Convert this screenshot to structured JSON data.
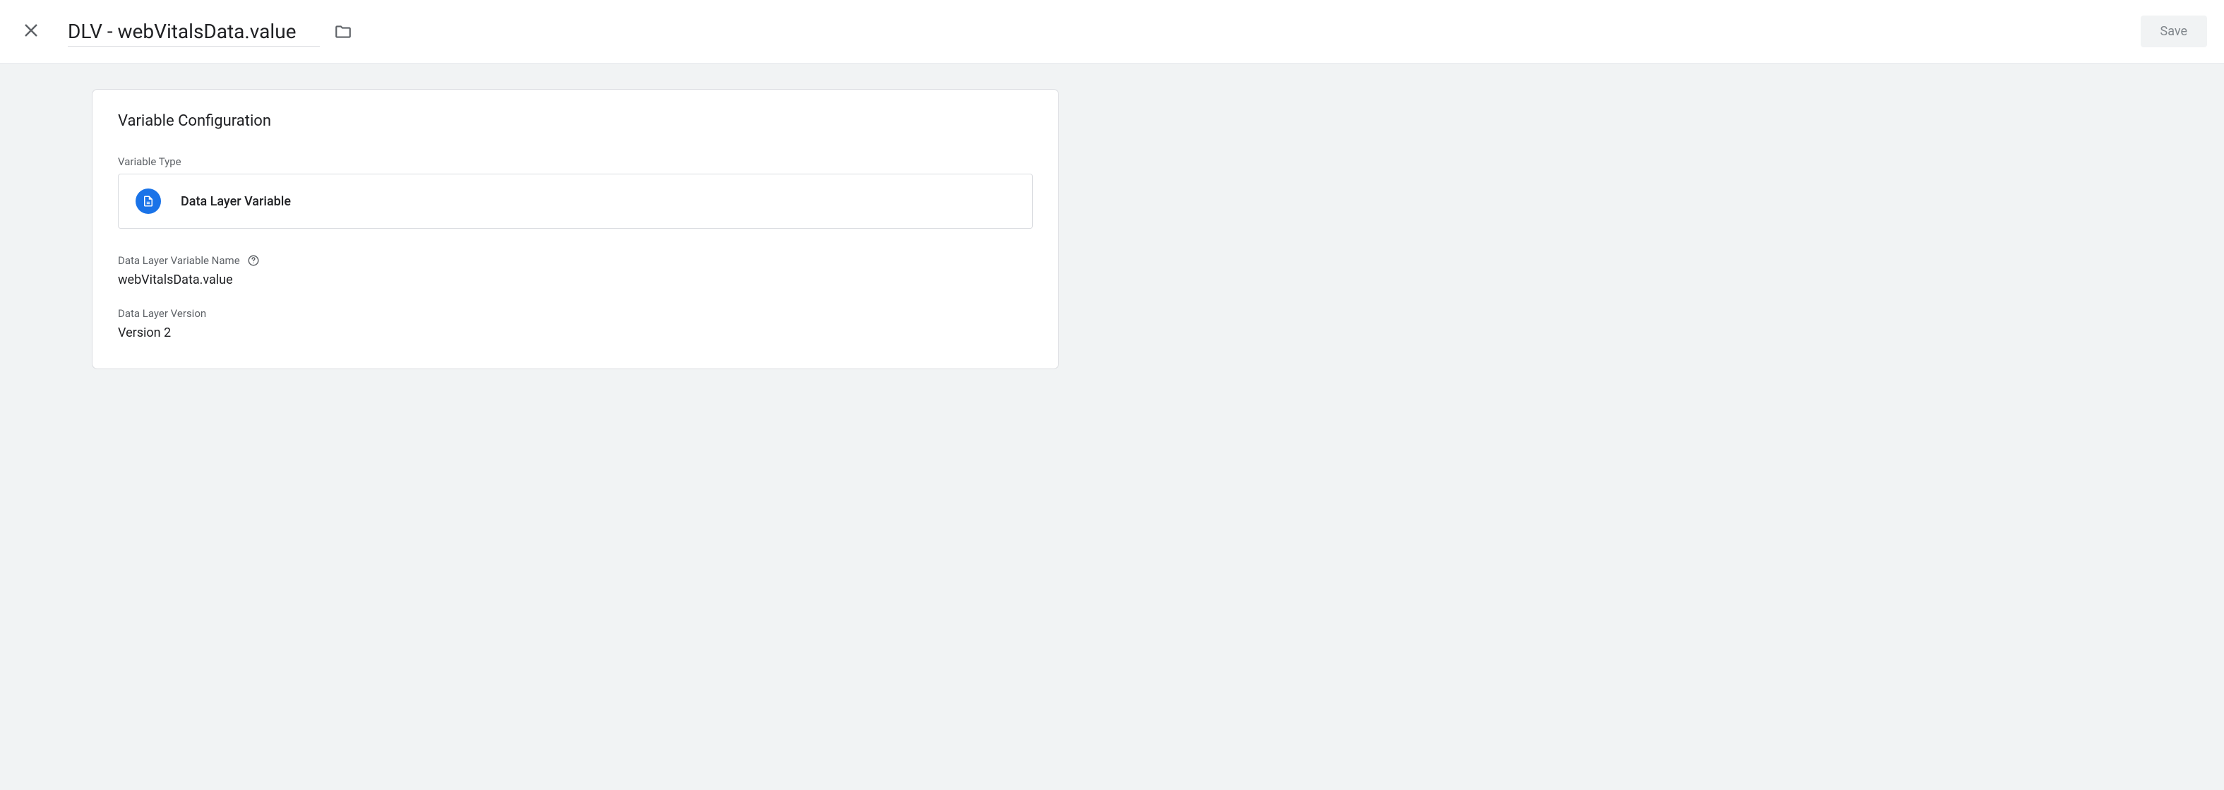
{
  "header": {
    "title": "DLV - webVitalsData.value",
    "save_label": "Save"
  },
  "card": {
    "title": "Variable Configuration",
    "type_label": "Variable Type",
    "type_name": "Data Layer Variable",
    "fields": {
      "variable_name": {
        "label": "Data Layer Variable Name",
        "value": "webVitalsData.value"
      },
      "version": {
        "label": "Data Layer Version",
        "value": "Version 2"
      }
    }
  }
}
